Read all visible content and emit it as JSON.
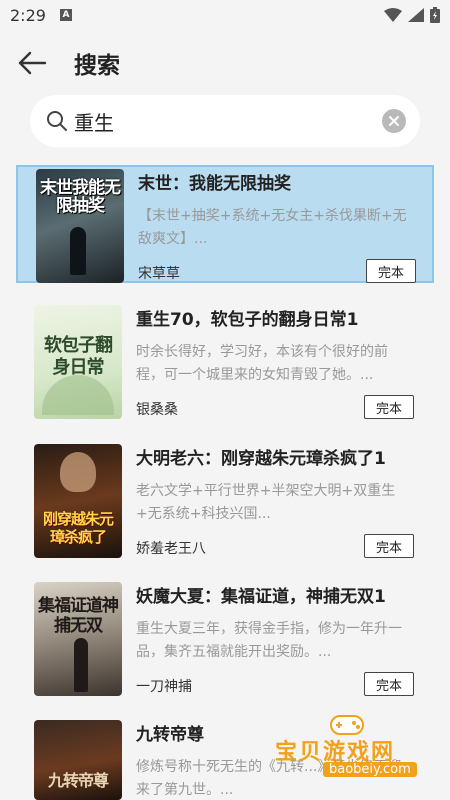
{
  "status_bar": {
    "time": "2:29",
    "sim_label": "A"
  },
  "header": {
    "title": "搜索"
  },
  "search": {
    "value": "重生"
  },
  "books": [
    {
      "title": "末世：我能无限抽奖",
      "desc": "【末世+抽奖+系统+无女主+杀伐果断+无敌爽文】...",
      "author": "宋草草",
      "status": "完本",
      "cover_text": "末世我能无限抽奖",
      "selected": true
    },
    {
      "title": "重生70，软包子的翻身日常1",
      "desc": "时余长得好，学习好，本该有个很好的前程，可一个城里来的女知青毁了她。...",
      "author": "银桑桑",
      "status": "完本",
      "cover_text": "软包子翻身日常"
    },
    {
      "title": "大明老六：刚穿越朱元璋杀疯了1",
      "desc": "老六文学+平行世界+半架空大明+双重生+无系统+科技兴国...",
      "author": "娇羞老王八",
      "status": "完本",
      "cover_text": "刚穿越朱元璋杀疯了"
    },
    {
      "title": "妖魔大夏：集福证道，神捕无双1",
      "desc": "重生大夏三年，获得金手指，修为一年升一品，集齐五福就能开出奖励。...",
      "author": "一刀神捕",
      "status": "完本",
      "cover_text": "集福证道神捕无双"
    },
    {
      "title": "九转帝尊",
      "desc": "修炼号称十死无生的《九转...》楚尘终于迎来了第九世。...",
      "author": "",
      "status": "",
      "cover_text": "九转帝尊"
    }
  ],
  "watermark": {
    "text": "宝贝游戏网",
    "sub": "baobeiy.com"
  }
}
